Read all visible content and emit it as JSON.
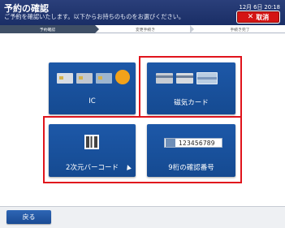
{
  "header": {
    "title": "予約の確認",
    "subtitle": "ご予約を確認いたします。以下からお持ちのものをお選びください。",
    "datetime": "12月 6日 20:18",
    "cancel_label": "取消"
  },
  "steps": [
    {
      "label": "予約確認",
      "active": true
    },
    {
      "label": "変更手続き",
      "active": false
    },
    {
      "label": "手続き完了",
      "active": false
    }
  ],
  "options": {
    "ic": {
      "label": "IC"
    },
    "magnetic": {
      "label": "磁気カード"
    },
    "qr": {
      "label": "2次元バーコード"
    },
    "number": {
      "label": "9桁の確認番号",
      "sample_number": "123456789"
    }
  },
  "footer": {
    "back_label": "戻る"
  },
  "colors": {
    "header": "#1a2e66",
    "button": "#1d58a8",
    "highlight": "#e0141c",
    "cancel": "#d41414"
  }
}
